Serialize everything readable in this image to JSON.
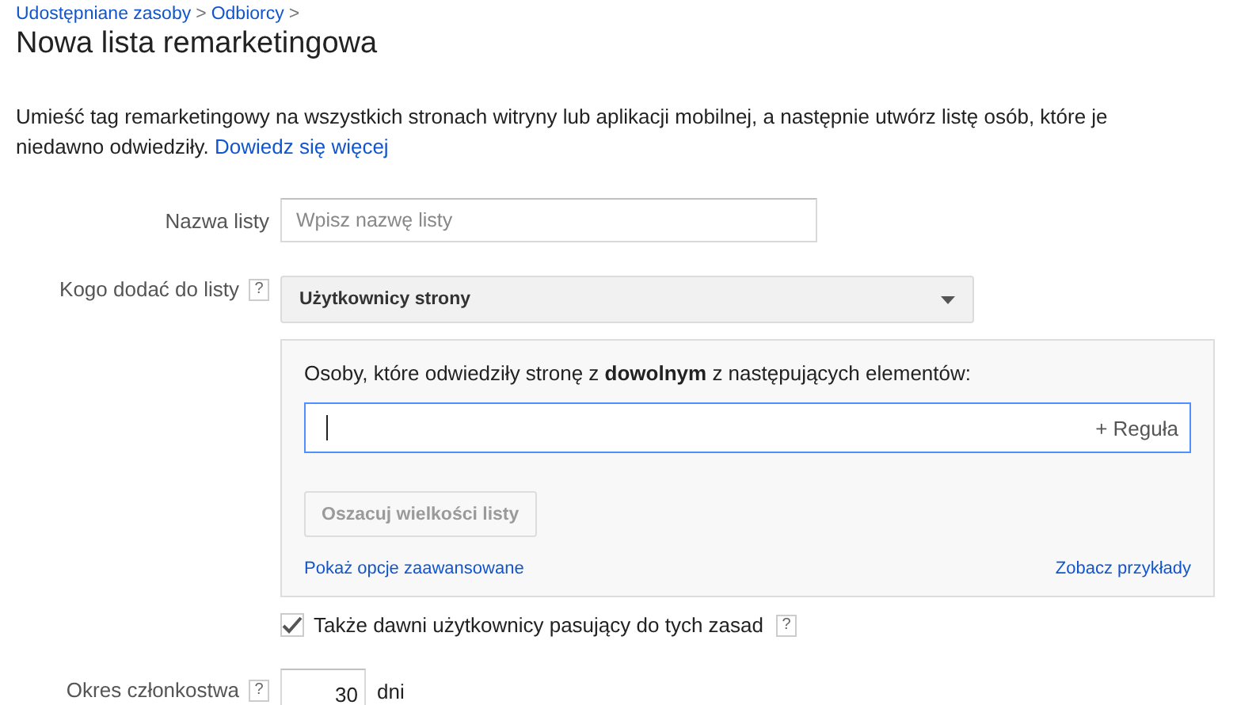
{
  "breadcrumb": [
    {
      "label": "Udostępniane zasoby",
      "separator": ">"
    },
    {
      "label": "Odbiorcy",
      "separator": ">"
    }
  ],
  "title": "Nowa lista remarketingowa",
  "description": {
    "text": "Umieść tag remarketingowy na wszystkich stronach witryny lub aplikacji mobilnej, a następnie utwórz listę osób, które je niedawno odwiedziły.",
    "link": "Dowiedz się więcej"
  },
  "list_name": {
    "label": "Nazwa listy",
    "placeholder": "Wpisz nazwę listy"
  },
  "who_to_add": {
    "label": "Kogo dodać do listy",
    "help": "?",
    "value": "Użytkownicy strony"
  },
  "rules": {
    "heading": "Osoby, które odwiedziły stronę z **dowolnym** z następujących elementów:",
    "add_rule": "+ Reguła",
    "estimate_button": {
      "label": "Oszacuj wielkości listy",
      "disabled": true
    },
    "advanced_link": "Pokaż opcje zaawansowane",
    "examples_link": "Zobacz przykłady"
  },
  "past_users": {
    "label": "Także dawni użytkownicy pasujący do tych zasad",
    "help": "?",
    "checked": true
  },
  "membership": {
    "label": "Okres członkostwa",
    "help": "?",
    "value": "30",
    "unit": "dni"
  }
}
